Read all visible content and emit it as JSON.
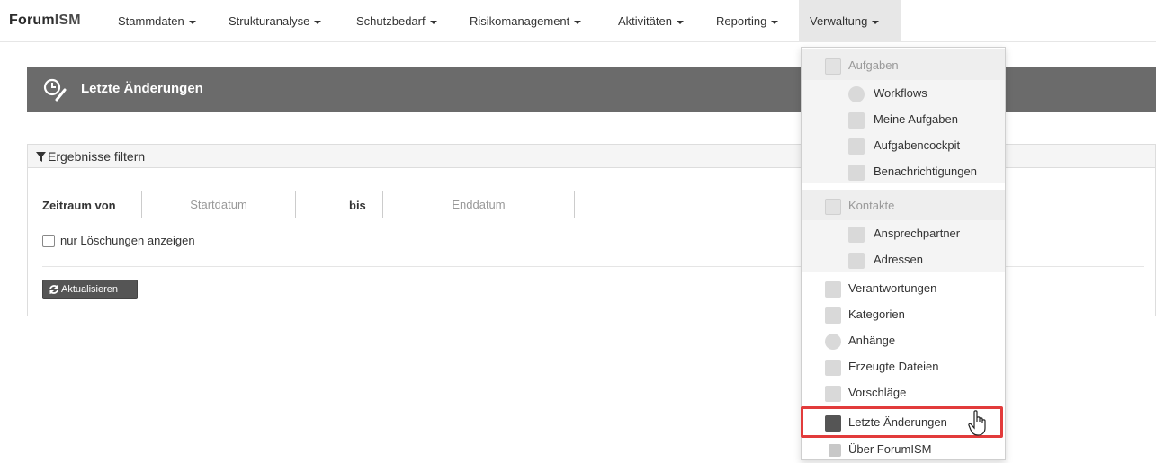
{
  "navbar": {
    "brand_prefix": "Forum",
    "brand_suffix": "ISM",
    "items": [
      {
        "label": "Stammdaten"
      },
      {
        "label": "Strukturanalyse"
      },
      {
        "label": "Schutzbedarf"
      },
      {
        "label": "Risikomanagement"
      },
      {
        "label": "Aktivitäten"
      },
      {
        "label": "Reporting"
      },
      {
        "label": "Verwaltung"
      }
    ]
  },
  "page": {
    "title": "Letzte Änderungen"
  },
  "filter": {
    "heading": "Ergebnisse filtern",
    "range_from_label": "Zeitraum von",
    "start_placeholder": "Startdatum",
    "range_to_label": "bis",
    "end_placeholder": "Enddatum",
    "only_deletions_label": "nur Löschungen anzeigen",
    "refresh_label": "Aktualisieren"
  },
  "menu": {
    "group_tasks": "Aufgaben",
    "tasks": [
      {
        "label": "Workflows",
        "icon": "eye-icon"
      },
      {
        "label": "Meine Aufgaben",
        "icon": "document-icon"
      },
      {
        "label": "Aufgabencockpit",
        "icon": "document-icon"
      },
      {
        "label": "Benachrichtigungen",
        "icon": "document-icon"
      }
    ],
    "group_contacts": "Kontakte",
    "contacts": [
      {
        "label": "Ansprechpartner",
        "icon": "phone-icon"
      },
      {
        "label": "Adressen",
        "icon": "address-card-icon"
      }
    ],
    "items": [
      {
        "label": "Verantwortungen",
        "icon": "user-icon"
      },
      {
        "label": "Kategorien",
        "icon": "folder-icon"
      },
      {
        "label": "Anhänge",
        "icon": "paperclip-icon"
      },
      {
        "label": "Erzeugte Dateien",
        "icon": "pdf-icon"
      },
      {
        "label": "Vorschläge",
        "icon": "list-icon"
      },
      {
        "label": "Letzte Änderungen",
        "icon": "clock-edit-icon"
      },
      {
        "label": "Über ForumISM",
        "icon": "info-cube-icon"
      }
    ],
    "highlight_color": "#e23b3b"
  }
}
